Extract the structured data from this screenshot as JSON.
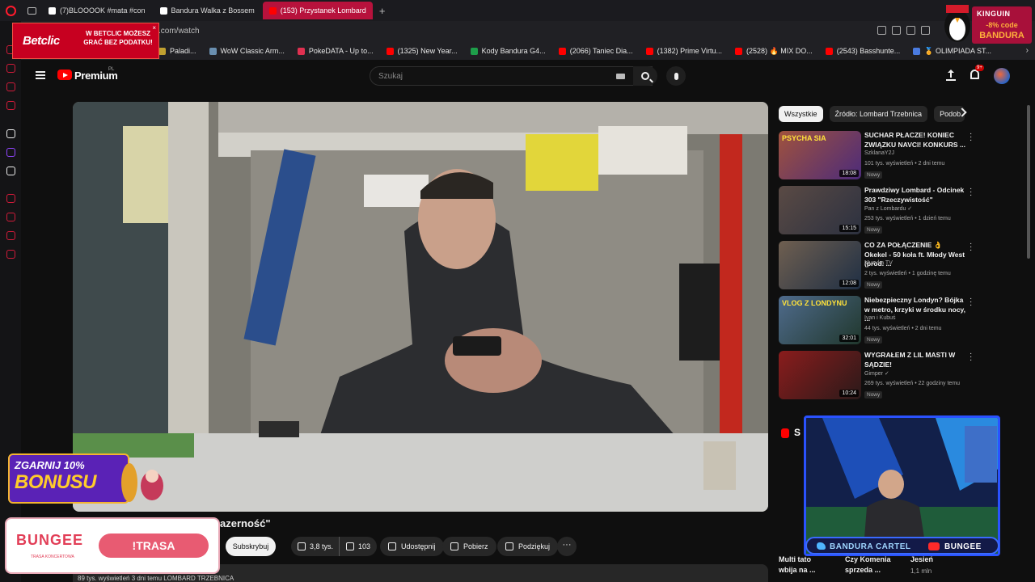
{
  "browser": {
    "tabs": [
      {
        "label": "(7)BLOOOOK #mata #con",
        "icon": "tiktok-icon",
        "color": "#ffffff",
        "active": false
      },
      {
        "label": "Bandura Walka z Bossem",
        "icon": "tiktok-icon",
        "color": "#ffffff",
        "active": false
      },
      {
        "label": "(153) Przystanek Lombard",
        "icon": "youtube-icon",
        "color": "#ff0000",
        "active": true
      }
    ],
    "url": ".com/watch",
    "bookmarks": [
      {
        "label": "Paladi...",
        "color": "#c0a030"
      },
      {
        "label": "WoW Classic Arm...",
        "color": "#6a8fb0"
      },
      {
        "label": "PokeDATA - Up to...",
        "color": "#e03050"
      },
      {
        "label": "(1325) New Year...",
        "color": "#ff0000"
      },
      {
        "label": "Kody Bandura G4...",
        "color": "#1e9e4a"
      },
      {
        "label": "(2066) Taniec Dia...",
        "color": "#ff0000"
      },
      {
        "label": "(1382) Prime Virtu...",
        "color": "#ff0000"
      },
      {
        "label": "(2528) 🔥 MIX DO...",
        "color": "#ff0000"
      },
      {
        "label": "(2543) Basshunte...",
        "color": "#ff0000"
      },
      {
        "label": "🏅 OLIMPIADA ST...",
        "color": "#4a7be0"
      }
    ]
  },
  "ads": {
    "betclic": {
      "logo": "Betclic",
      "tagline": "W BETCLIC MOŻESZ GRAĆ BEZ PODATKU!",
      "close": "×"
    },
    "kinguin": {
      "name": "KINGUIN",
      "code": "-8% code",
      "brand": "BANDURA"
    },
    "bonus": {
      "line1": "ZGARNIJ 10%",
      "line2": "BONUSU"
    },
    "bungee": {
      "logo": "BUNGEE",
      "sub": "TRASA KONCERTOWA",
      "button": "!TRASA"
    },
    "stream_bar": {
      "left": "BANDURA CARTEL",
      "right": "BUNGEE"
    }
  },
  "youtube": {
    "logo_text": "Premium",
    "logo_sup": "PL",
    "search_placeholder": "Szukaj",
    "notification_badge": "9+",
    "video": {
      "title_fragment": "azerność\"",
      "subscribe": "Subskrybuj",
      "likes": "3,8 tys.",
      "dislikes": "103",
      "share": "Udostępnij",
      "download": "Pobierz",
      "thanks": "Podziękuj",
      "more": "···",
      "views_line": "89 tys. wyświetleń  3 dni temu  LOMBARD TRZEBNICA"
    },
    "chips": [
      "Wszystkie",
      "Źródło: Lombard Trzebnica",
      "Podob"
    ],
    "recommendations": [
      {
        "title": "SUCHAR PŁACZE! KONIEC ZWIĄZKU NAVCI! KONKURS ...",
        "channel": "SzklanaY2J",
        "meta": "101 tys. wyświetleń • 2 dni temu",
        "badge": "Nowy",
        "duration": "18:08",
        "thumb_text": "PSYCHA SIA"
      },
      {
        "title": "Prawdziwy Lombard - Odcinek 303 \"Rzeczywistość\"",
        "channel": "Pan z Lombardu ✓",
        "meta": "253 tys. wyświetleń • 1 dzień temu",
        "badge": "Nowy",
        "duration": "15:15",
        "thumb_text": ""
      },
      {
        "title": "CO ZA POŁĄCZENIE 👌 Okekel - 50 koła ft. Młody West (prod. ...",
        "channel": "Muzyka TV",
        "meta": "2 tys. wyświetleń • 1 godzinę temu",
        "badge": "Nowy",
        "duration": "12:08",
        "thumb_text": ""
      },
      {
        "title": "Niebezpieczny Londyn? Bójka w metro, krzyki w środku nocy, ...",
        "channel": "Ivan i Kubuś",
        "meta": "44 tys. wyświetleń • 2 dni temu",
        "badge": "Nowy",
        "duration": "32:01",
        "thumb_text": "VLOG Z LONDYNU"
      },
      {
        "title": "WYGRAŁEM Z LIL MASTI W SĄDZIE!",
        "channel": "Gimper ✓",
        "meta": "269 tys. wyświetleń • 22 godziny temu",
        "badge": "Nowy",
        "duration": "10:24",
        "thumb_text": ""
      }
    ],
    "shorts": {
      "label": "S",
      "items": [
        {
          "title": "Multi tato",
          "title2": "wbija na ...",
          "meta": ""
        },
        {
          "title": "Czy Komenia",
          "title2": "sprzeda ...",
          "meta": ""
        },
        {
          "title": "Jesień",
          "title2": "",
          "meta": "1,1 mln"
        }
      ]
    }
  }
}
